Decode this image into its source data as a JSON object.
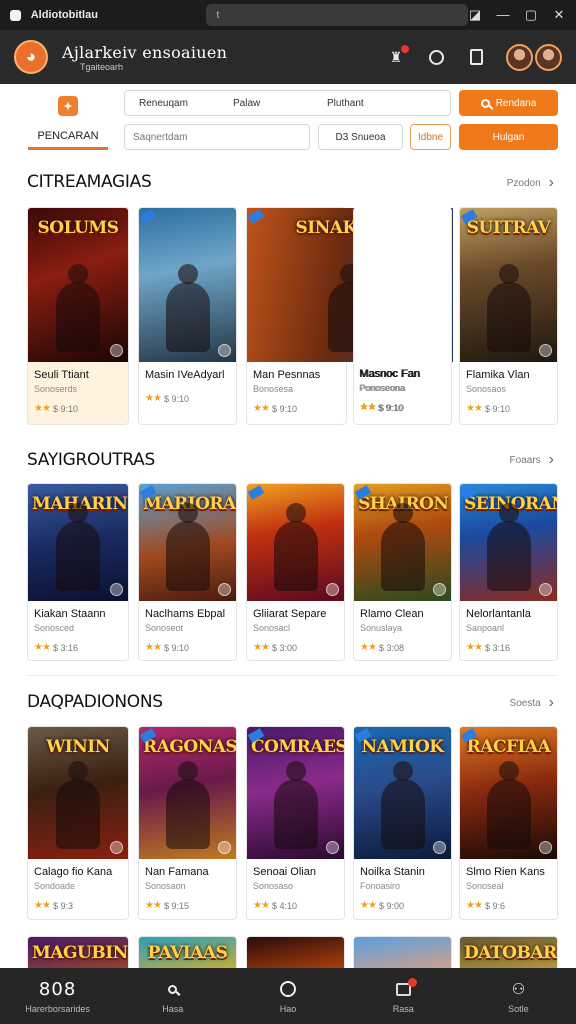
{
  "window": {
    "title": "Aldiotobitlau",
    "address": "t"
  },
  "header": {
    "brand_main": "Ajlarkeiv ensoaiuen",
    "brand_sub": "Tgaiteoarh",
    "logo_glyph": "◕",
    "accent": "#e8702a"
  },
  "search": {
    "tab_label": "PENCARAN",
    "filters": [
      "Reneuqam",
      "Palaw",
      "Pluthant"
    ],
    "input_placeholder": "Saqnertdam",
    "sort_label": "D3 Snueoa",
    "more_label": "Idbne",
    "button_one": "Rendana",
    "button_two": "Hulgan"
  },
  "sections": [
    {
      "title": "CITREAMAGIAS",
      "more": "Pzodon",
      "cards": [
        {
          "cover": "SOLUMS",
          "title": "Seuli Ttiant",
          "sub": "Sonoserds",
          "rating": "$ 9:10",
          "g": "linear-gradient(160deg,#3a0a08,#8a1e10 40%,#1a0505)"
        },
        {
          "cover": "",
          "title": "Masin IVeAdyarl",
          "sub": "",
          "rating": "$ 9:10",
          "g": "linear-gradient(170deg,#2d6ea0,#6fa6c8 40%,#243646)"
        },
        {
          "cover": "SINAKTESS",
          "title": "Man Pesnnas",
          "sub": "Bonosesa",
          "rating": "$ 9:10",
          "g": "linear-gradient(100deg,#c0541a,#6a2a10 45%,#1d3a6a)"
        },
        {
          "cover": "",
          "title": "Masnoc Fan",
          "sub": "Ponoseona",
          "rating": "$ 9:10",
          "g": "linear-gradient(100deg,#5a2a10,#1d3a6a 50%,#5aa0d8)"
        },
        {
          "cover": "SUITRAV",
          "title": "Flamika Vlan",
          "sub": "Sonosaos",
          "rating": "$ 9:10",
          "g": "linear-gradient(170deg,#c0a060,#6a4a2a 40%,#201810)"
        }
      ]
    },
    {
      "title": "SAYIGROUTRAS",
      "more": "Foaars",
      "cards": [
        {
          "cover": "MAHARIN",
          "title": "Kiakan Staann",
          "sub": "Sonosced",
          "rating": "$ 3:16",
          "g": "linear-gradient(170deg,#3a5aa0,#1a2a60 50%,#0a1030)"
        },
        {
          "cover": "MARIORAIN",
          "title": "Naclhams Ebpal",
          "sub": "Sonoseot",
          "rating": "$ 9:10",
          "g": "linear-gradient(170deg,#5aa0d0,#a04a20 55%,#4a1a10)"
        },
        {
          "cover": "",
          "title": "Gliiarat Separe",
          "sub": "Sonosacl",
          "rating": "$ 3:00",
          "g": "linear-gradient(170deg,#f0a020,#c03010 40%,#5a0a20)"
        },
        {
          "cover": "SHAIRON",
          "title": "Rlamo Clean",
          "sub": "Sonuslaya",
          "rating": "$ 3:08",
          "g": "linear-gradient(170deg,#e0a020,#b04a10 40%,#2a4a20)"
        },
        {
          "cover": "SEINORAN",
          "title": "Nelorlantanla",
          "sub": "Sanpoanl",
          "rating": "$ 3:16",
          "g": "linear-gradient(170deg,#2a8ad8,#1a4aa0 40%,#8a2a20)"
        }
      ]
    },
    {
      "title": "DAQPADIONONS",
      "more": "Soesta",
      "cards": [
        {
          "cover": "WININ",
          "title": "Calago fio Kana",
          "sub": "Sondoade",
          "rating": "$ 9:3",
          "g": "linear-gradient(170deg,#6a5a4a,#3a2010 45%,#8a2010)"
        },
        {
          "cover": "RAGONAS",
          "title": "Nan Famana",
          "sub": "Sonosaon",
          "rating": "$ 9:15",
          "g": "linear-gradient(170deg,#b02a6a,#6a1a4a 45%,#c07a20)"
        },
        {
          "cover": "COMRAES",
          "title": "Senoai Olian",
          "sub": "Sonosaso",
          "rating": "$ 4:10",
          "g": "linear-gradient(170deg,#4a1a6a,#8a2a8a 45%,#2a0a30)"
        },
        {
          "cover": "NAMIOK",
          "title": "Noilka Stanin",
          "sub": "Fonoasiro",
          "rating": "$ 9:00",
          "g": "linear-gradient(170deg,#1a6ab0,#2a4a8a 45%,#0a1a3a)"
        },
        {
          "cover": "RACFIAA",
          "title": "Slmo Rien Kans",
          "sub": "Sonoseal",
          "rating": "$ 9:6",
          "g": "linear-gradient(170deg,#e07a20,#8a2a10 45%,#1a0a05)"
        }
      ]
    },
    {
      "title": "",
      "more": "",
      "cards": [
        {
          "cover": "MAGUBIN",
          "g": "linear-gradient(170deg,#4a1a6a,#a04a20)"
        },
        {
          "cover": "PAVIAAS",
          "g": "linear-gradient(170deg,#2aa0c0,#e0b020)"
        },
        {
          "cover": "",
          "g": "linear-gradient(170deg,#2a0a0a,#c04a10)"
        },
        {
          "cover": "",
          "g": "linear-gradient(170deg,#5aa0e0,#e0a080)"
        },
        {
          "cover": "DATOBAR",
          "g": "linear-gradient(170deg,#6a5a30,#c0a040)"
        }
      ]
    }
  ],
  "bottom_nav": [
    {
      "icon": "home-icon",
      "glyph": "808",
      "label": "Harerborsarides"
    },
    {
      "icon": "search-icon",
      "glyph": "",
      "label": "Hasa"
    },
    {
      "icon": "circle-icon",
      "glyph": "",
      "label": "Hao"
    },
    {
      "icon": "inbox-icon",
      "glyph": "",
      "label": "Rasa"
    },
    {
      "icon": "profile-icon",
      "glyph": "",
      "label": "Sotle"
    }
  ]
}
